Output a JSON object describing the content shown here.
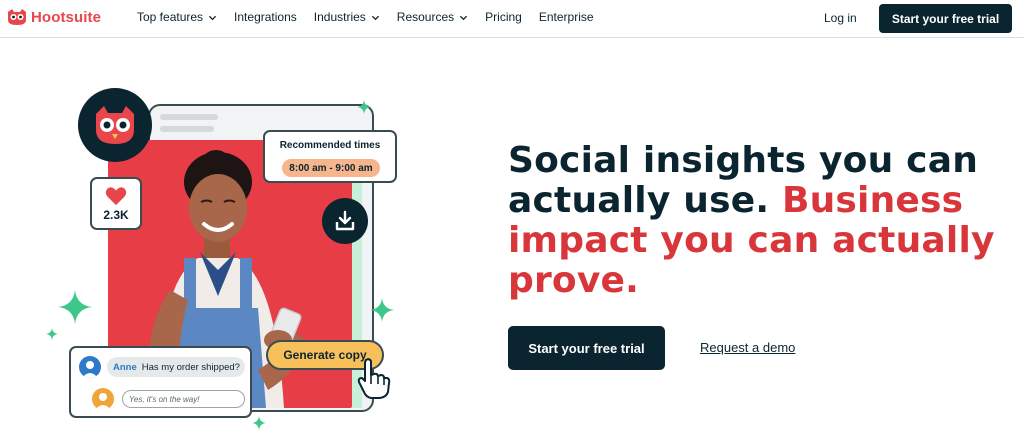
{
  "brand": {
    "name": "Hootsuite",
    "color": "#e8464a"
  },
  "nav": {
    "items": [
      {
        "label": "Top features",
        "has_dropdown": true
      },
      {
        "label": "Integrations",
        "has_dropdown": false
      },
      {
        "label": "Industries",
        "has_dropdown": true
      },
      {
        "label": "Resources",
        "has_dropdown": true
      },
      {
        "label": "Pricing",
        "has_dropdown": false
      },
      {
        "label": "Enterprise",
        "has_dropdown": false
      }
    ],
    "login_label": "Log in",
    "cta_label": "Start your free trial"
  },
  "hero": {
    "headline_part1": "Social insights you can actually use.",
    "headline_part2": "Business impact you can actually prove.",
    "primary_cta": "Start your free trial",
    "secondary_cta": "Request a demo"
  },
  "illustration": {
    "like_count": "2.3K",
    "recommended_title": "Recommended times",
    "recommended_time": "8:00 am - 9:00 am",
    "chat_name": "Anne",
    "chat_message": "Has my order shipped?",
    "chat_reply_placeholder": "Yes, it's on the way!",
    "generate_button": "Generate copy"
  },
  "colors": {
    "navy": "#0b2530",
    "accent_red": "#d9363b",
    "photo_red": "#e63d47",
    "sparkle_green": "#3ec78a",
    "button_yellow": "#f7c05a",
    "time_pill": "#f6b58c"
  }
}
